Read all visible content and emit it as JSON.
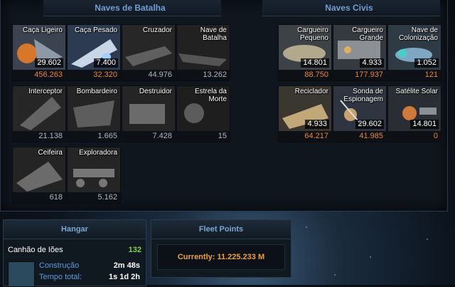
{
  "military": {
    "title": "Naves de Batalha",
    "ships": [
      {
        "name": "Caça Ligeiro",
        "count": "29.602",
        "available": "456.263",
        "avail_color": "orange"
      },
      {
        "name": "Caça Pesado",
        "count": "7.400",
        "available": "32.320",
        "avail_color": "orange"
      },
      {
        "name": "Cruzador",
        "count": "",
        "available": "44.976",
        "avail_color": "gray"
      },
      {
        "name": "Nave de Batalha",
        "count": "",
        "available": "13.262",
        "avail_color": "gray"
      },
      {
        "name": "Interceptor",
        "count": "",
        "available": "21.138",
        "avail_color": "gray"
      },
      {
        "name": "Bombardeiro",
        "count": "",
        "available": "1.665",
        "avail_color": "gray"
      },
      {
        "name": "Destruidor",
        "count": "",
        "available": "7.428",
        "avail_color": "gray"
      },
      {
        "name": "Estrela da Morte",
        "count": "",
        "available": "15",
        "avail_color": "gray"
      },
      {
        "name": "Ceifeira",
        "count": "",
        "available": "618",
        "avail_color": "gray"
      },
      {
        "name": "Exploradora",
        "count": "",
        "available": "5.162",
        "avail_color": "gray"
      }
    ]
  },
  "civil": {
    "title": "Naves Civis",
    "ships": [
      {
        "name": "Cargueiro Pequeno",
        "count": "14.801",
        "available": "88.750",
        "avail_color": "orange"
      },
      {
        "name": "Cargueiro Grande",
        "count": "4.933",
        "available": "177.937",
        "avail_color": "orange"
      },
      {
        "name": "Nave de Colonização",
        "count": "1.052",
        "available": "121",
        "avail_color": "orange"
      },
      {
        "name": "Reciclador",
        "count": "4.933",
        "available": "64.217",
        "avail_color": "orange"
      },
      {
        "name": "Sonda de Espionagem",
        "count": "29.602",
        "available": "41.985",
        "avail_color": "orange"
      },
      {
        "name": "Satélite Solar",
        "count": "14.801",
        "available": "0",
        "avail_color": "orange"
      }
    ]
  },
  "hangar": {
    "title": "Hangar",
    "item": "Canhão de Iões",
    "quantity": "132",
    "build_label": "Construção",
    "build_time": "2m 48s",
    "total_label": "Tempo total:",
    "total_time": "1s 1d 2h"
  },
  "fleet_points": {
    "title": "Fleet Points",
    "current": "Currently: 11.225.233 M"
  },
  "colors": {
    "accent_title": "#6f9fd4",
    "orange": "#e8863b",
    "green": "#7fd24a"
  }
}
